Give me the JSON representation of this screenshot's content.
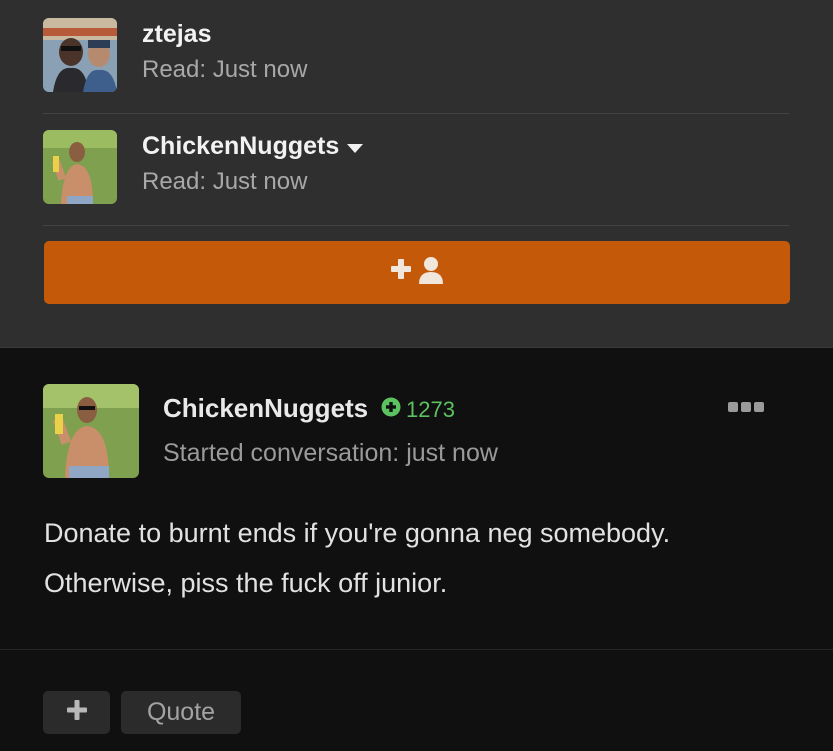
{
  "participants": [
    {
      "name": "ztejas",
      "read": "Read: Just now",
      "avatar_icon": "avatar-photo-two-men-sunglasses"
    },
    {
      "name": "ChickenNuggets",
      "read": "Read: Just now",
      "avatar_icon": "avatar-photo-man-water-gun",
      "has_dropdown": true
    }
  ],
  "add_participant": {
    "icon": "add-user-icon",
    "color": "#c45a09"
  },
  "post": {
    "author": "ChickenNuggets",
    "reputation": "1273",
    "reputation_color": "#5cc160",
    "started": "Started conversation: just now",
    "body_line1": "Donate to burnt ends if you're gonna neg somebody.",
    "body_line2": "Otherwise, piss the fuck off junior.",
    "actions": {
      "plus_icon": "plus-icon",
      "quote_label": "Quote"
    }
  }
}
